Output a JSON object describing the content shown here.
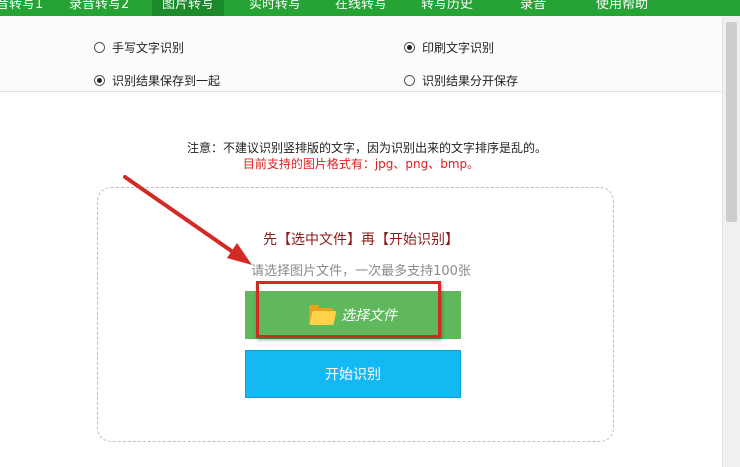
{
  "nav": {
    "tabs": [
      {
        "label": "音转写1"
      },
      {
        "label": "录音转写2"
      },
      {
        "label": "图片转写"
      },
      {
        "label": "实时转写"
      },
      {
        "label": "在线转写"
      },
      {
        "label": "转写历史"
      },
      {
        "label": "录音"
      },
      {
        "label": "使用帮助"
      }
    ],
    "active_tab": "图片转写"
  },
  "options": {
    "handwriting": {
      "label": "手写文字识别",
      "checked": false
    },
    "printed": {
      "label": "印刷文字识别",
      "checked": true
    },
    "save_together": {
      "label": "识别结果保存到一起",
      "checked": true
    },
    "save_separate": {
      "label": "识别结果分开保存",
      "checked": false
    }
  },
  "notes": {
    "warning": "注意：不建议识别竖排版的文字，因为识别出来的文字排序是乱的。",
    "formats": "目前支持的图片格式有：jpg、png、bmp。"
  },
  "upload": {
    "instruction": "先【选中文件】再【开始识别】",
    "hint": "请选择图片文件，一次最多支持100张",
    "choose_label": "选择文件",
    "start_label": "开始识别"
  },
  "colors": {
    "nav_green": "#25a335",
    "choose_green": "#5fb85b",
    "start_blue": "#14b9f3",
    "highlight_red": "#d42a24",
    "note_red": "#e02020"
  }
}
